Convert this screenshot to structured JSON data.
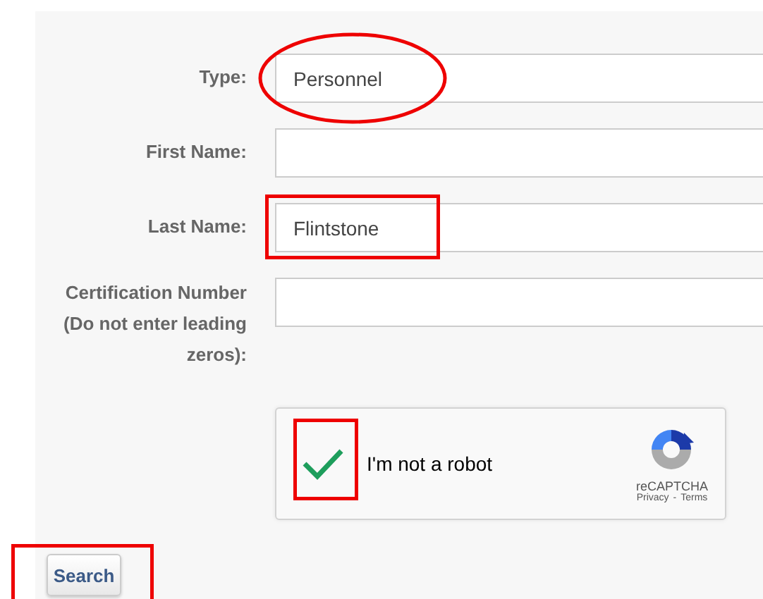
{
  "fields": [
    {
      "label": "Type:",
      "value": "Personnel",
      "circled": true,
      "boxed": false
    },
    {
      "label": "First Name:",
      "circled": false,
      "boxed": false
    },
    {
      "label": "Last Name:",
      "value": "Flintstone",
      "circled": false,
      "boxed": true
    },
    {
      "label": "Certification Number (Do not enter leading zeros):",
      "circled": false,
      "boxed": false
    }
  ],
  "captcha": {
    "checked": true,
    "label": "I'm not a robot",
    "brand": "reCAPTCHA",
    "privacy": "Privacy",
    "separator": "-",
    "terms": "Terms",
    "boxed": true
  },
  "search_button": {
    "label": "Search",
    "boxed": true
  }
}
